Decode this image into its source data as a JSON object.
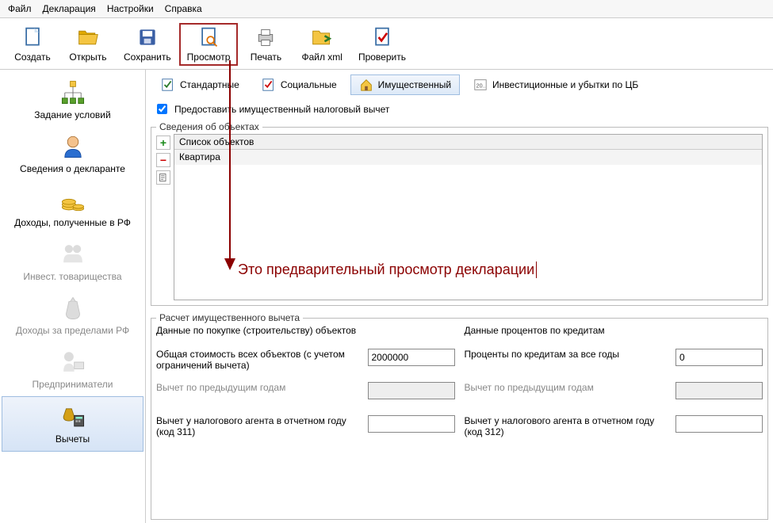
{
  "menu": {
    "file": "Файл",
    "declaration": "Декларация",
    "settings": "Настройки",
    "help": "Справка"
  },
  "toolbar": {
    "create": "Создать",
    "open": "Открыть",
    "save": "Сохранить",
    "preview": "Просмотр",
    "print": "Печать",
    "file_xml": "Файл xml",
    "check": "Проверить"
  },
  "sidebar": {
    "conditions": "Задание условий",
    "declarant": "Сведения о декларанте",
    "income_rf": "Доходы, полученные в РФ",
    "invest_partnerships": "Инвест. товарищества",
    "income_abroad": "Доходы за пределами РФ",
    "entrepreneurs": "Предприниматели",
    "deductions": "Вычеты"
  },
  "tabs": {
    "standard": "Стандартные",
    "social": "Социальные",
    "property": "Имущественный",
    "invest": "Инвестиционные и убытки по ЦБ"
  },
  "checkbox_label": "Предоставить имущественный налоговый вычет",
  "objects": {
    "legend": "Сведения об объектах",
    "header": "Список объектов",
    "row1": "Квартира"
  },
  "calc": {
    "legend": "Расчет имущественного вычета",
    "purchase_title": "Данные по покупке (строительству) объектов",
    "interest_title": "Данные процентов по кредитам",
    "total_cost": "Общая стоимость всех объектов (с учетом ограничений вычета)",
    "total_cost_value": "2000000",
    "credit_interest": "Проценты по кредитам за все годы",
    "credit_interest_value": "0",
    "prev_years": "Вычет по предыдущим годам",
    "agent_311": "Вычет у налогового агента в отчетном году (код 311)",
    "agent_312": "Вычет у налогового агента в отчетном году (код 312)"
  },
  "annotation": "Это предварительный просмотр декларации"
}
